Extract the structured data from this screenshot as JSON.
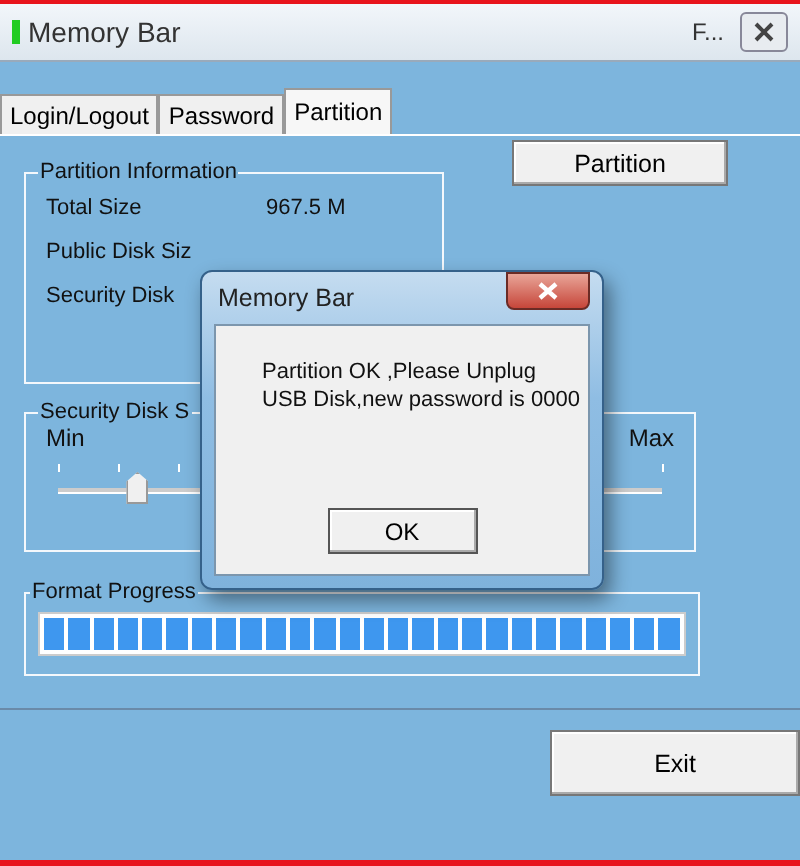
{
  "window": {
    "title": "Memory Bar",
    "title_right": "F..."
  },
  "tabs": [
    {
      "label": "Login/Logout",
      "selected": false
    },
    {
      "label": "Password",
      "selected": false
    },
    {
      "label": "Partition",
      "selected": true
    }
  ],
  "partition_info": {
    "title": "Partition Information",
    "rows": [
      {
        "label": "Total Size",
        "value": "967.5 M"
      },
      {
        "label": "Public Disk Siz"
      },
      {
        "label": "Security Disk"
      }
    ]
  },
  "partition_button": "Partition",
  "security_disk": {
    "title": "Security Disk S",
    "min_label": "Min",
    "max_label": "Max",
    "level": 0.13
  },
  "format_progress": {
    "title": "Format Progress",
    "level": 1
  },
  "exit_button": "Exit",
  "dialog": {
    "title": "Memory Bar",
    "message": "Partition OK ,Please Unplug USB Disk,new password is 0000",
    "button": "OK"
  }
}
